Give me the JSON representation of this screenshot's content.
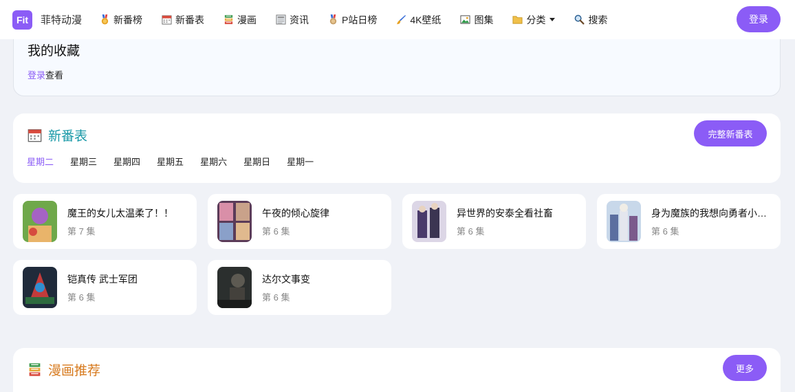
{
  "header": {
    "logo_badge": "Fit",
    "site_name": "菲特动漫",
    "nav": [
      {
        "label": "新番榜",
        "icon": "medal-icon"
      },
      {
        "label": "新番表",
        "icon": "calendar-icon"
      },
      {
        "label": "漫画",
        "icon": "books-icon"
      },
      {
        "label": "资讯",
        "icon": "newspaper-icon"
      },
      {
        "label": "P站日榜",
        "icon": "medal-icon"
      },
      {
        "label": "4K壁纸",
        "icon": "paintbrush-icon"
      },
      {
        "label": "图集",
        "icon": "picture-icon"
      },
      {
        "label": "分类",
        "icon": "folder-icon"
      },
      {
        "label": "搜索",
        "icon": "search-icon"
      }
    ],
    "login_label": "登录"
  },
  "favorites": {
    "title": "我的收藏",
    "login_link": "登录",
    "after_link": "查看"
  },
  "schedule": {
    "title": "新番表",
    "full_button": "完整新番表",
    "days": [
      "星期二",
      "星期三",
      "星期四",
      "星期五",
      "星期六",
      "星期日",
      "星期一"
    ],
    "active_day": "星期二"
  },
  "anime": [
    {
      "title": "魔王的女儿太温柔了！！",
      "episode": "第 7 集"
    },
    {
      "title": "午夜的倾心旋律",
      "episode": "第 6 集"
    },
    {
      "title": "异世界的安泰全看社畜",
      "episode": "第 6 集"
    },
    {
      "title": "身为魔族的我想向勇者小队的跟班",
      "episode": "第 6 集"
    },
    {
      "title": "铠真传 武士军团",
      "episode": "第 6 集"
    },
    {
      "title": "达尔文事变",
      "episode": "第 6 集"
    }
  ],
  "manga": {
    "title": "漫画推荐",
    "more_button": "更多"
  },
  "colors": {
    "accent": "#8b5cf6",
    "teal_title": "#1b9aa8",
    "orange_title": "#d77a1e",
    "page_bg": "#f0f2f7"
  }
}
